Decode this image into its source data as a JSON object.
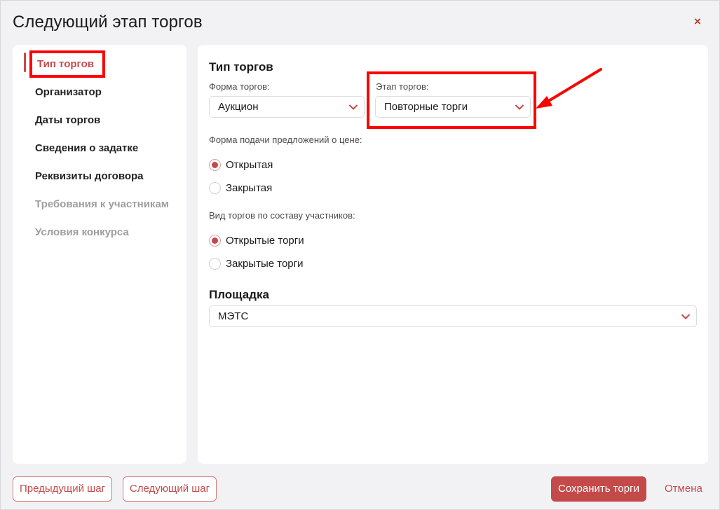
{
  "modal": {
    "title": "Следующий этап торгов",
    "close_label": "×"
  },
  "sidebar": {
    "items": [
      {
        "label": "Тип торгов",
        "state": "active"
      },
      {
        "label": "Организатор",
        "state": "normal"
      },
      {
        "label": "Даты торгов",
        "state": "normal"
      },
      {
        "label": "Сведения о задатке",
        "state": "normal"
      },
      {
        "label": "Реквизиты договора",
        "state": "normal"
      },
      {
        "label": "Требования к участникам",
        "state": "disabled"
      },
      {
        "label": "Условия конкурса",
        "state": "disabled"
      }
    ]
  },
  "form": {
    "section_type_title": "Тип торгов",
    "trade_form": {
      "label": "Форма торгов:",
      "value": "Аукцион"
    },
    "trade_stage": {
      "label": "Этап торгов:",
      "value": "Повторные торги"
    },
    "price_offer": {
      "label": "Форма подачи предложений о цене:",
      "options": [
        {
          "label": "Открытая",
          "checked": true
        },
        {
          "label": "Закрытая",
          "checked": false
        }
      ]
    },
    "participants": {
      "label": "Вид торгов по составу участников:",
      "options": [
        {
          "label": "Открытые торги",
          "checked": true
        },
        {
          "label": "Закрытые торги",
          "checked": false
        }
      ]
    },
    "section_platform_title": "Площадка",
    "platform": {
      "value": "МЭТС"
    }
  },
  "footer": {
    "prev_label": "Предыдущий шаг",
    "next_label": "Следующий шаг",
    "save_label": "Сохранить торги",
    "cancel_label": "Отмена"
  },
  "colors": {
    "accent": "#c44a4a",
    "annotation": "#ff0000",
    "background": "#f2f2f4"
  }
}
